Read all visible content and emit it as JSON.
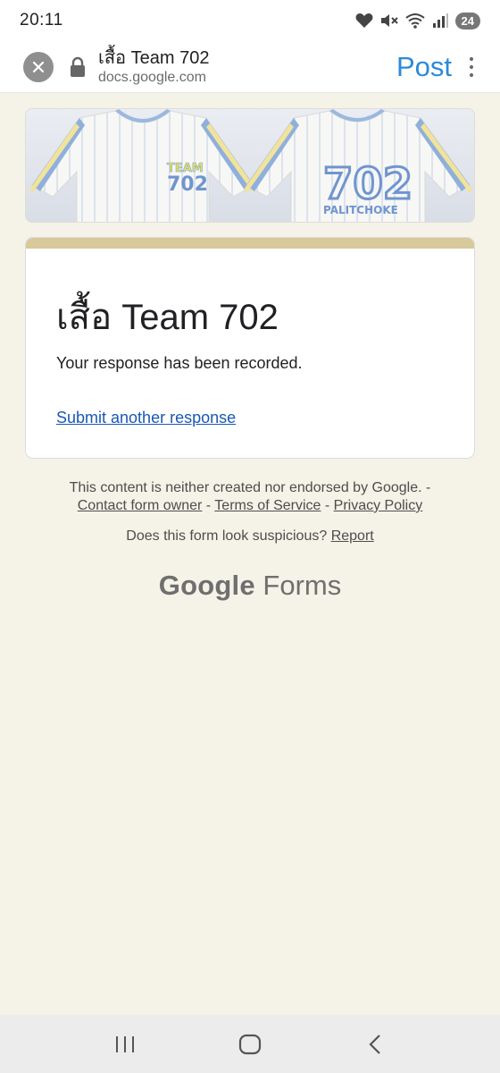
{
  "status": {
    "time": "20:11",
    "battery": "24",
    "icons": [
      "heart-icon",
      "mute-icon",
      "wifi-icon",
      "signal-icon"
    ]
  },
  "browser": {
    "title": "เสื้อ Team 702",
    "domain": "docs.google.com",
    "post_label": "Post",
    "icons": [
      "close-icon",
      "lock-icon",
      "more-vert-icon"
    ]
  },
  "banner": {
    "shirt_left_text_1": "TEAM",
    "shirt_left_text_2": "702",
    "shirt_right_number": "702",
    "shirt_right_name": "PALITCHOKE"
  },
  "card": {
    "title": "เสื้อ Team 702",
    "message": "Your response has been recorded.",
    "link": "Submit another response"
  },
  "footer": {
    "disclaimer": "This content is neither created nor endorsed by Google. -",
    "contact": "Contact form owner",
    "terms": "Terms of Service",
    "privacy": "Privacy Policy",
    "sep": " - ",
    "suspicious_question": "Does this form look suspicious?",
    "report": "Report",
    "brand_google": "Google",
    "brand_forms": "Forms"
  },
  "colors": {
    "page_bg": "#f5f2e7",
    "card_accent": "#d8c99a",
    "link": "#1a58b5",
    "post": "#2b8ad9"
  }
}
